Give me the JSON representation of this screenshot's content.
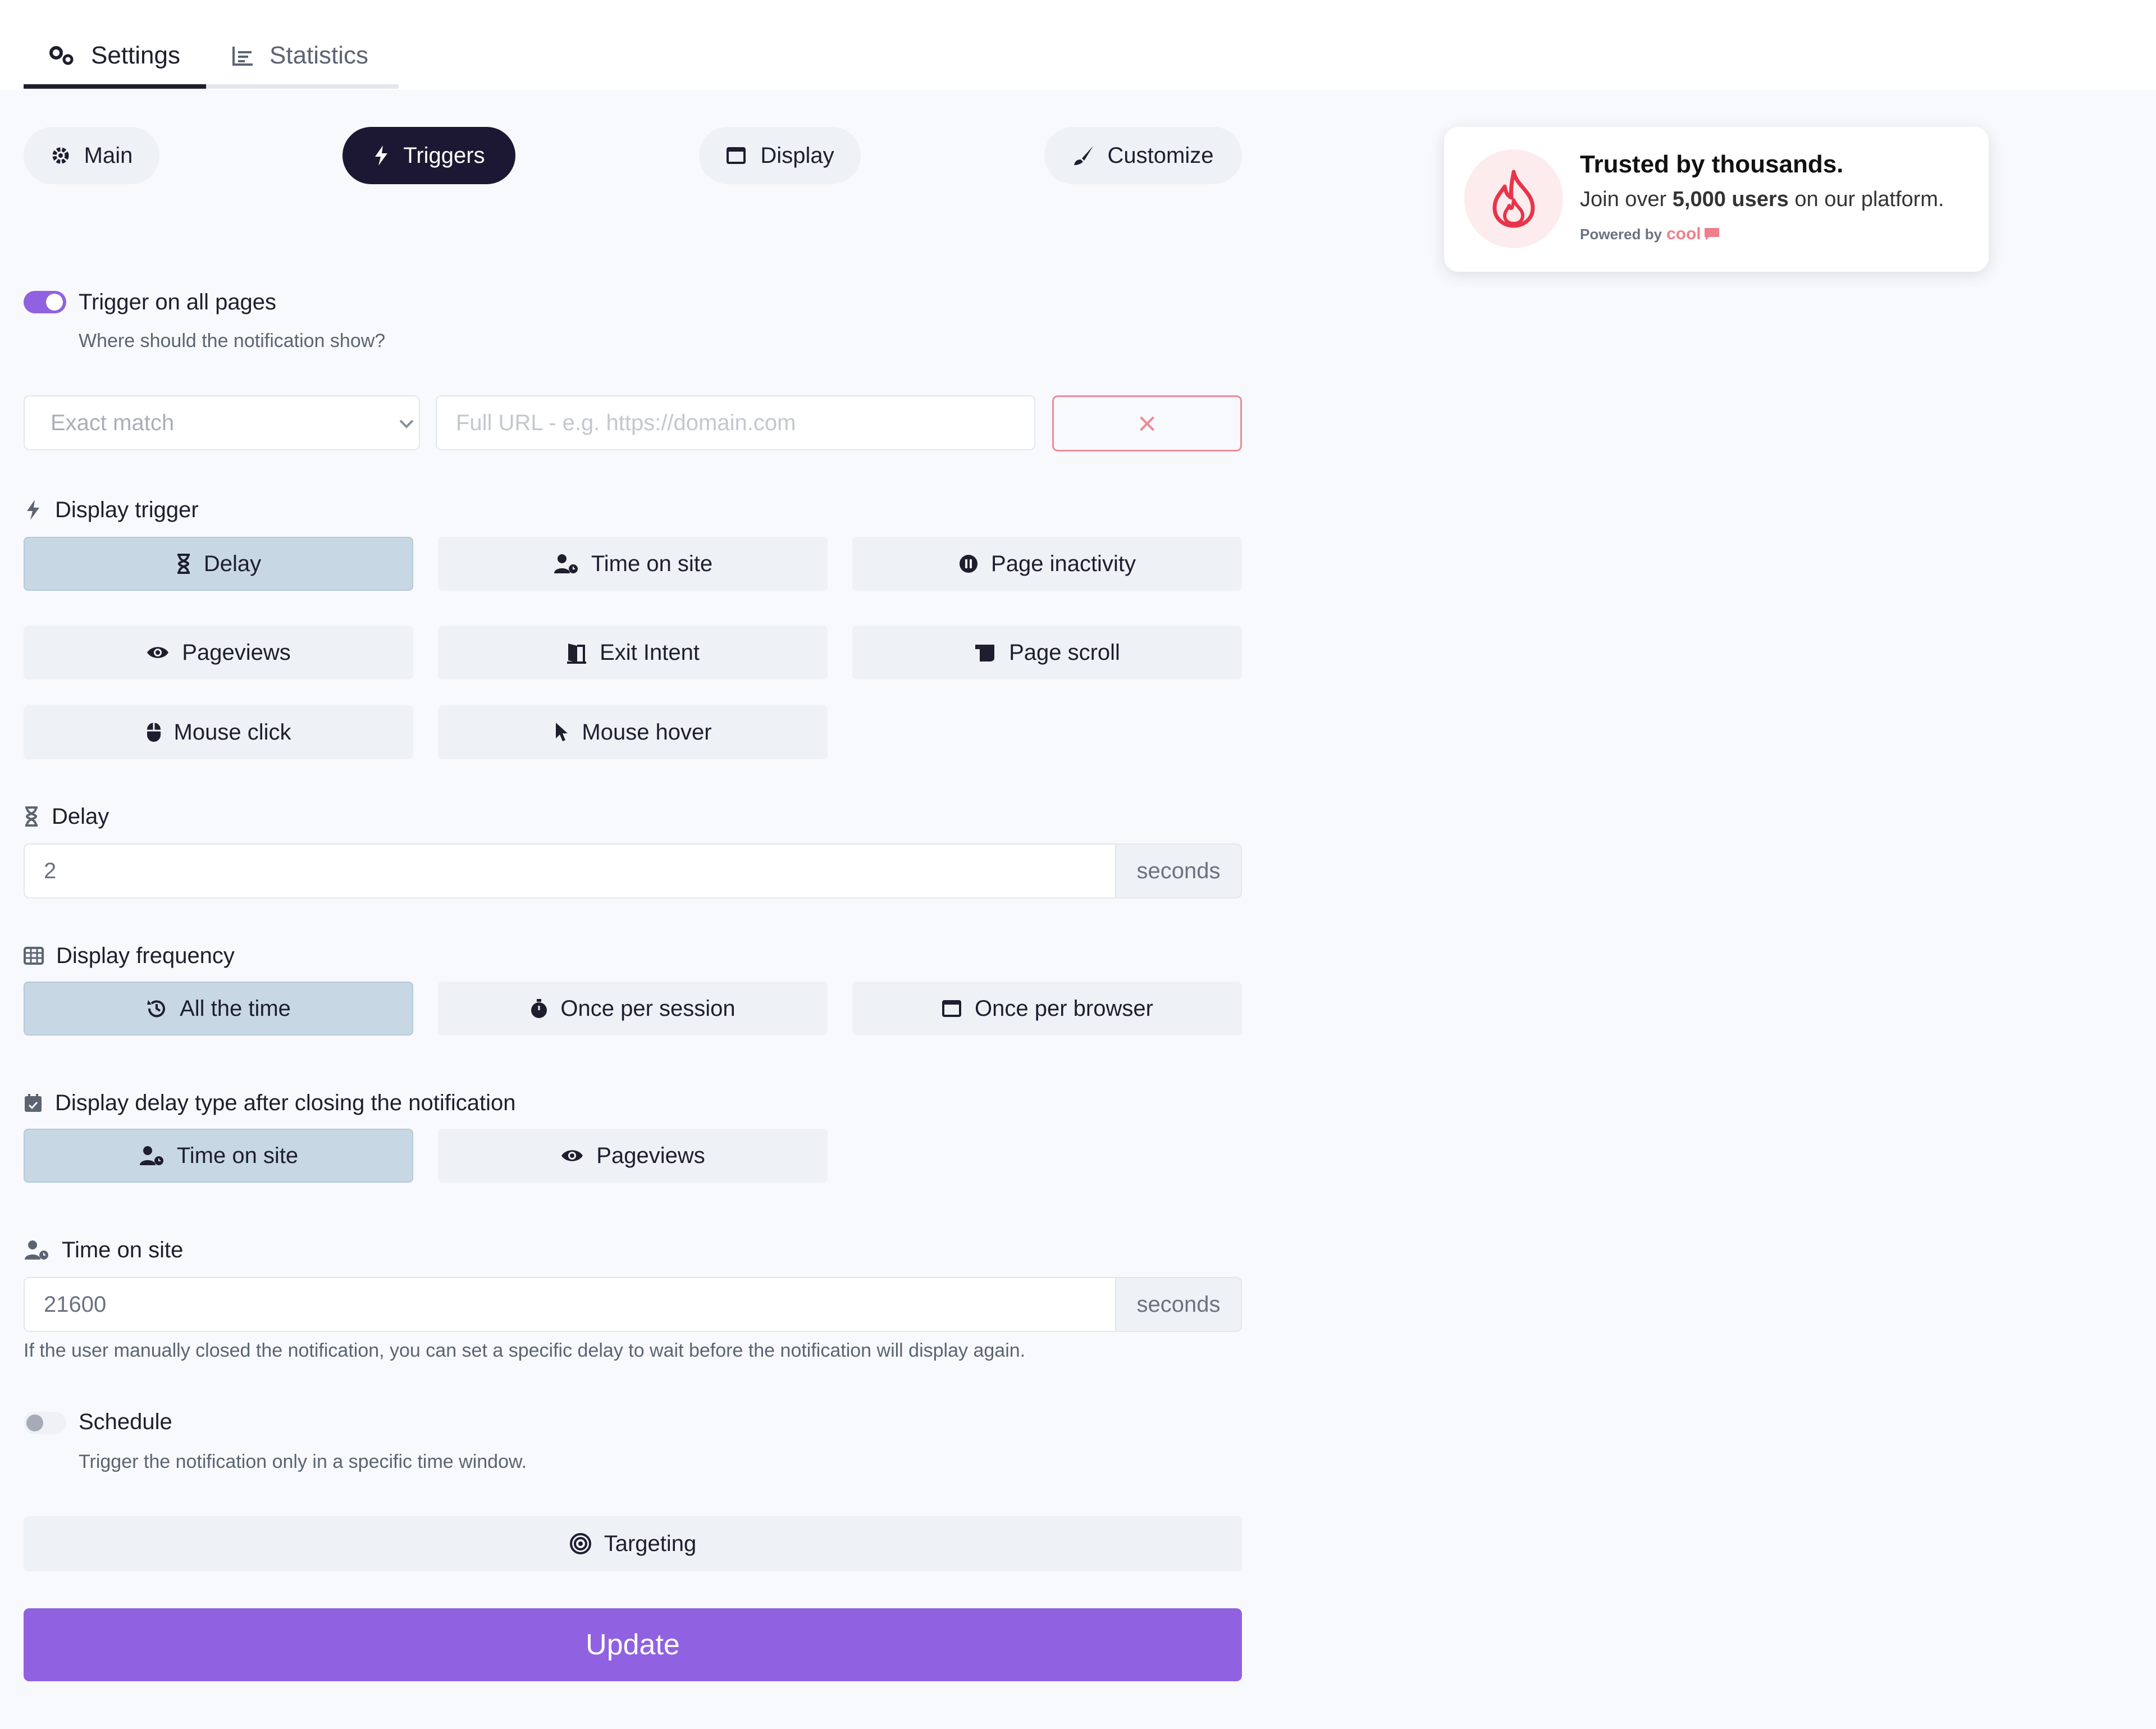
{
  "tabs": [
    {
      "label": "Settings",
      "icon": "gears-icon",
      "active": true
    },
    {
      "label": "Statistics",
      "icon": "bar-chart-icon",
      "active": false
    }
  ],
  "subtabs": [
    {
      "label": "Main",
      "icon": "gear-icon"
    },
    {
      "label": "Triggers",
      "icon": "bolt-icon",
      "active": true
    },
    {
      "label": "Display",
      "icon": "window-icon"
    },
    {
      "label": "Customize",
      "icon": "paint-brush-icon"
    }
  ],
  "trigger_all": {
    "label": "Trigger on all pages",
    "help": "Where should the notification show?",
    "on": true
  },
  "url_rule": {
    "match_placeholder": "Exact match",
    "url_placeholder": "Full URL - e.g. https://domain.com",
    "remove_symbol": "×"
  },
  "display_trigger": {
    "label": "Display trigger",
    "options": [
      "Delay",
      "Time on site",
      "Page inactivity",
      "Pageviews",
      "Exit Intent",
      "Page scroll",
      "Mouse click",
      "Mouse hover"
    ],
    "selected": "Delay"
  },
  "delay": {
    "label": "Delay",
    "value": "2",
    "unit": "seconds"
  },
  "frequency": {
    "label": "Display frequency",
    "options": [
      "All the time",
      "Once per session",
      "Once per browser"
    ],
    "selected": "All the time"
  },
  "delay_type": {
    "label": "Display delay type after closing the notification",
    "options": [
      "Time on site",
      "Pageviews"
    ],
    "selected": "Time on site"
  },
  "time_on_site": {
    "label": "Time on site",
    "value": "21600",
    "unit": "seconds",
    "help": "If the user manually closed the notification, you can set a specific delay to wait before the notification will display again."
  },
  "schedule": {
    "label": "Schedule",
    "help": "Trigger the notification only in a specific time window.",
    "on": false
  },
  "targeting": {
    "label": "Targeting"
  },
  "update": {
    "label": "Update"
  },
  "preview": {
    "title": "Trusted by thousands.",
    "text_pre": "Join over",
    "text_bold": "5,000 users",
    "text_post": "on our platform.",
    "powered_by": "Powered by",
    "brand": "cool"
  },
  "colors": {
    "accent": "#9061e0",
    "dark_pill": "#1c1833",
    "selected_option": "#c8d7e4",
    "danger": "#ef8b97",
    "flame": "#e8344a"
  }
}
